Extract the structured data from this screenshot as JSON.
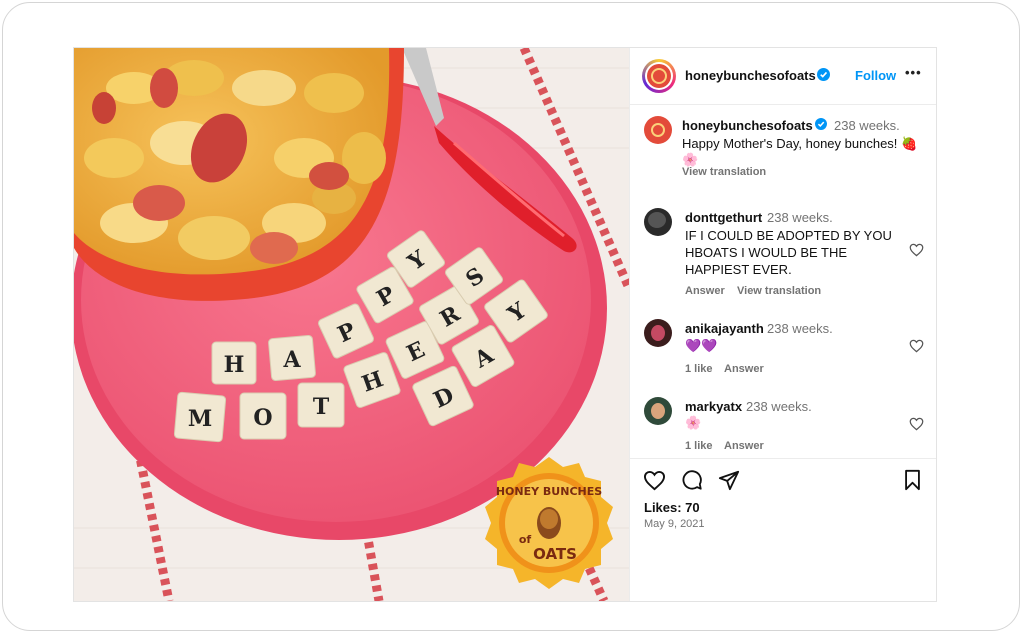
{
  "header": {
    "username": "honeybunchesofoats",
    "follow_label": "Follow",
    "more_label": "•••"
  },
  "caption": {
    "username": "honeybunchesofoats",
    "time": "238 weeks.",
    "text": "Happy Mother's Day, honey bunches! 🍓",
    "text2": "🌸",
    "view_translation": "View translation"
  },
  "comments": [
    {
      "username": "donttgethurt",
      "time": "238 weeks.",
      "lines": [
        "IF I COULD BE ADOPTED BY YOU",
        "HBOATS I WOULD BE THE",
        "HAPPIEST EVER."
      ],
      "answer": "Answer",
      "view_translation": "View translation"
    },
    {
      "username": "anikajayanth",
      "time": "238 weeks.",
      "lines": [
        "💜💜"
      ],
      "likes": "1 like",
      "answer": "Answer"
    },
    {
      "username": "markyatx",
      "time": "238 weeks.",
      "lines": [
        "🌸"
      ],
      "likes": "1 like",
      "answer": "Answer"
    }
  ],
  "footer": {
    "likes": "Likes: 70",
    "date": "May 9, 2021"
  },
  "photo": {
    "tiles_row1": [
      "H",
      "A",
      "P",
      "P",
      "Y"
    ],
    "tiles_row2": [
      "M",
      "O",
      "T",
      "H",
      "E",
      "R",
      "S"
    ],
    "tiles_day": [
      "D",
      "A",
      "Y"
    ],
    "logo_line1": "HONEY BUNCHES",
    "logo_line2": "of",
    "logo_line3": "OATS"
  },
  "colors": {
    "accent_blue": "#0095f6",
    "plate_pink": "#f0607a",
    "bowl_red": "#e8452f",
    "logo_orange": "#f29a1e"
  }
}
